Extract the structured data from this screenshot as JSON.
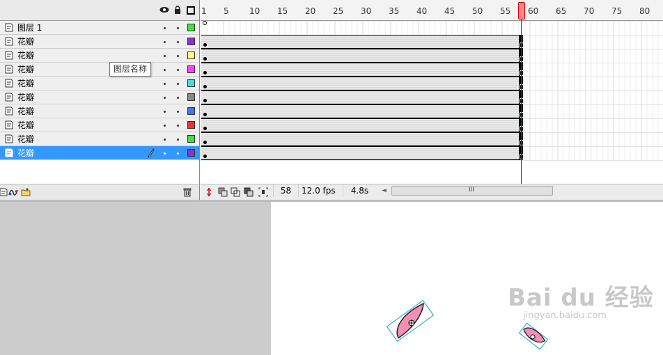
{
  "header_icons": {
    "visibility": "eye-icon",
    "lock": "lock-icon",
    "outline": "outline-square-icon"
  },
  "layers": [
    {
      "name": "图层 1",
      "color": "#44dd44",
      "selected": false
    },
    {
      "name": "花瓣",
      "color": "#8833cc",
      "selected": false
    },
    {
      "name": "花瓣",
      "color": "#ffff88",
      "selected": false
    },
    {
      "name": "花瓣",
      "color": "#ff44ff",
      "selected": false
    },
    {
      "name": "花瓣",
      "color": "#44dddd",
      "selected": false
    },
    {
      "name": "花瓣",
      "color": "#888888",
      "selected": false
    },
    {
      "name": "花瓣",
      "color": "#4477ee",
      "selected": false
    },
    {
      "name": "花瓣",
      "color": "#ee3333",
      "selected": false
    },
    {
      "name": "花瓣",
      "color": "#44dd44",
      "selected": false
    },
    {
      "name": "花瓣",
      "color": "#8833cc",
      "selected": true
    }
  ],
  "tooltip": "图层名称",
  "ruler_labels": [
    "1",
    "5",
    "10",
    "15",
    "20",
    "25",
    "30",
    "35",
    "40",
    "45",
    "50",
    "55",
    "60",
    "65",
    "70",
    "75",
    "80"
  ],
  "status": {
    "current_frame": "58",
    "fps": "12.0 fps",
    "elapsed": "4.8s",
    "scroll_left": "◄",
    "scroll_grip": "III"
  },
  "colors": {
    "selected_row": "#3399ff",
    "playhead": "#cc0000",
    "petal_fill": "#f38fb4",
    "bounding_box": "#33aadd"
  },
  "watermark": {
    "main": "Bai du 经验",
    "sub": "jingyan.baidu.com"
  }
}
